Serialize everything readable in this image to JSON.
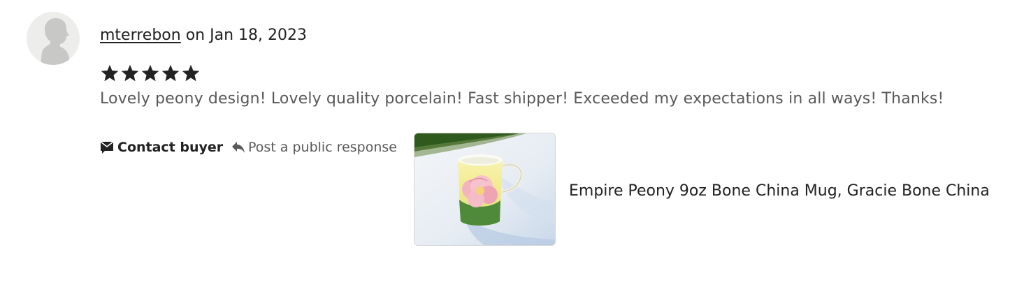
{
  "review": {
    "username": "mterrebon",
    "date_text": " on Jan 18, 2023",
    "rating": 5,
    "rating_max": 5,
    "text": "Lovely peony design! Lovely quality porcelain! Fast shipper! Exceeded my expectations in all ways! Thanks!"
  },
  "actions": {
    "contact_label": "Contact buyer",
    "contact_icon": "message-icon",
    "response_label": "Post a public response",
    "response_icon": "reply-icon"
  },
  "product": {
    "title": "Empire Peony 9oz Bone China Mug, Gracie Bone China"
  },
  "colors": {
    "text_primary": "#222222",
    "text_secondary": "#595959",
    "avatar_bg": "#ededeb"
  }
}
